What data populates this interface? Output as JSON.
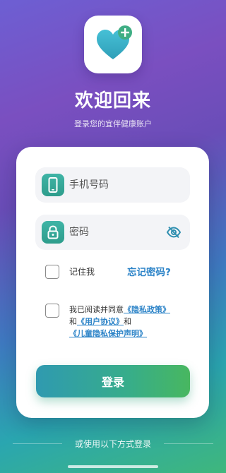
{
  "header": {
    "title": "欢迎回来",
    "subtitle": "登录您的宜伴健康账户"
  },
  "form": {
    "phone_placeholder": "手机号码",
    "password_placeholder": "密码",
    "remember_label": "记住我",
    "forgot_label": "忘记密码?",
    "agree_prefix": "我已阅读并同意",
    "privacy_link": "《隐私政策》",
    "and_text": "和",
    "user_agreement_link": "《用户协议》",
    "and_text_2": "和",
    "child_privacy_link": "《儿童隐私保护声明》",
    "login_label": "登录"
  },
  "footer": {
    "other_login": "或使用以下方式登录"
  },
  "colors": {
    "accent": "#2d84c8",
    "brand_green": "#37ad8a",
    "heart": "#3fb3c8"
  },
  "icons": [
    "heart-plus-icon",
    "phone-icon",
    "lock-icon",
    "eye-off-icon"
  ]
}
